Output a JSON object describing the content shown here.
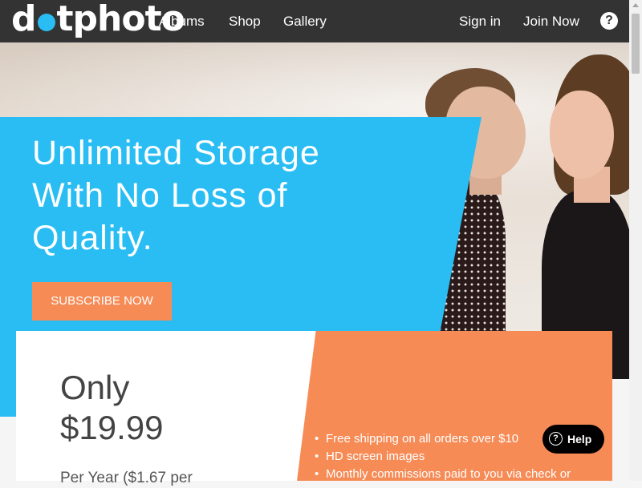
{
  "header": {
    "logo_left": "d",
    "logo_right": "tphoto",
    "nav": [
      "Albums",
      "Shop",
      "Gallery"
    ],
    "sign_in": "Sign in",
    "join_now": "Join Now",
    "help_icon": "?"
  },
  "hero": {
    "title": "Unlimited Storage With No Loss of Quality.",
    "cta_label": "SUBSCRIBE NOW"
  },
  "pricing": {
    "line1": "Only",
    "price": "$19.99",
    "per_year": "Per Year ($1.67 per",
    "features": [
      "Free shipping on all orders over $10",
      "HD screen images",
      "Monthly commissions paid to you via check or"
    ],
    "bullet": "•"
  },
  "help_widget": {
    "icon": "?",
    "label": "Help"
  },
  "colors": {
    "accent_blue": "#29bdf3",
    "accent_orange": "#f68b56",
    "header_bg": "#333333"
  }
}
